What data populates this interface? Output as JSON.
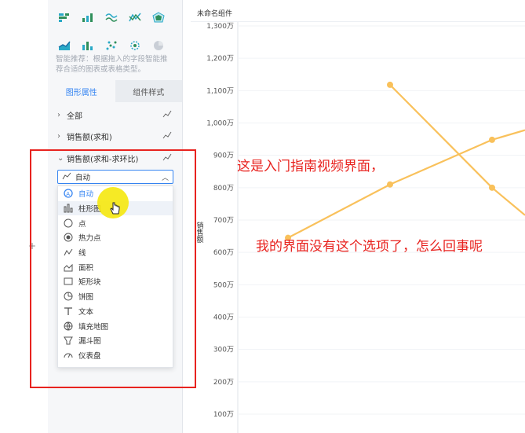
{
  "panel": {
    "hint": "智能推荐：根据拖入的字段智能推荐合适的图表或表格类型。",
    "tabs": [
      {
        "label": "图形属性"
      },
      {
        "label": "组件样式"
      }
    ],
    "rows": [
      {
        "label": "全部"
      },
      {
        "label": "销售额(求和)"
      },
      {
        "label": "销售额(求和-求环比)"
      }
    ]
  },
  "select": {
    "value": "自动"
  },
  "dropdown": {
    "options": [
      {
        "label": "自动",
        "icon": "auto-icon"
      },
      {
        "label": "柱形图",
        "icon": "bar-chart-icon"
      },
      {
        "label": "点",
        "icon": "point-icon"
      },
      {
        "label": "热力点",
        "icon": "heat-point-icon"
      },
      {
        "label": "线",
        "icon": "line-icon"
      },
      {
        "label": "面积",
        "icon": "area-icon"
      },
      {
        "label": "矩形块",
        "icon": "rect-block-icon"
      },
      {
        "label": "饼图",
        "icon": "pie-icon"
      },
      {
        "label": "文本",
        "icon": "text-icon"
      },
      {
        "label": "填充地图",
        "icon": "fill-map-icon"
      },
      {
        "label": "漏斗图",
        "icon": "funnel-icon"
      },
      {
        "label": "仪表盘",
        "icon": "gauge-icon"
      }
    ]
  },
  "chart_title": "未命名组件",
  "annotations": {
    "line1": "这是入门指南视频界面，",
    "line2": "我的界面没有这个选项了，怎么回事呢"
  },
  "colors": {
    "accent": "#3685f2",
    "series": "#f9c15b",
    "annotation": "#e8231f",
    "highlight": "#f5e80d"
  },
  "chart_data": {
    "type": "line",
    "ylabel": "销售额",
    "ylim": [
      100,
      1300
    ],
    "yticks": [
      "100万",
      "200万",
      "300万",
      "400万",
      "500万",
      "600万",
      "700万",
      "800万",
      "900万",
      "1,000万",
      "1,100万",
      "1,200万",
      "1,300万"
    ],
    "series": [
      {
        "values": [
          645,
          810,
          948,
          978
        ]
      },
      {
        "values": [
          1118,
          800,
          715
        ]
      }
    ]
  }
}
